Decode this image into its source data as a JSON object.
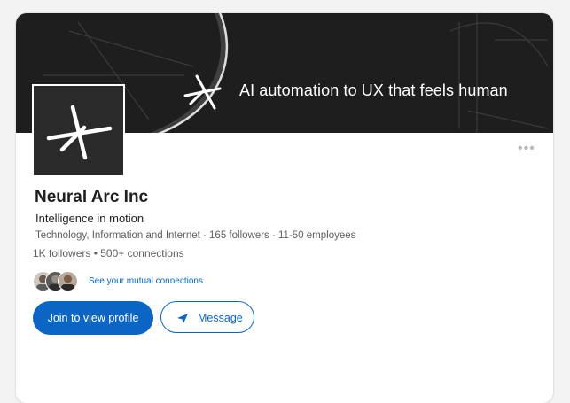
{
  "banner": {
    "tagline": "AI automation to UX that feels human"
  },
  "company": {
    "name": "Neural Arc Inc",
    "tagline": "Intelligence in motion",
    "meta": "Technology, Information and Internet · 165 followers · 11-50 employees",
    "followers": "1K followers • 500+ connections"
  },
  "mutual": {
    "link_text": "See your mutual connections"
  },
  "actions": {
    "join_label": "Join to view profile",
    "message_label": "Message"
  },
  "icons": {
    "more": "ellipsis-icon",
    "send": "send-icon",
    "logo": "asterisk-logo-icon"
  },
  "colors": {
    "accent": "#0a66c2",
    "banner_bg": "#1e1e1e",
    "logo_bg": "#2a2a2a"
  }
}
